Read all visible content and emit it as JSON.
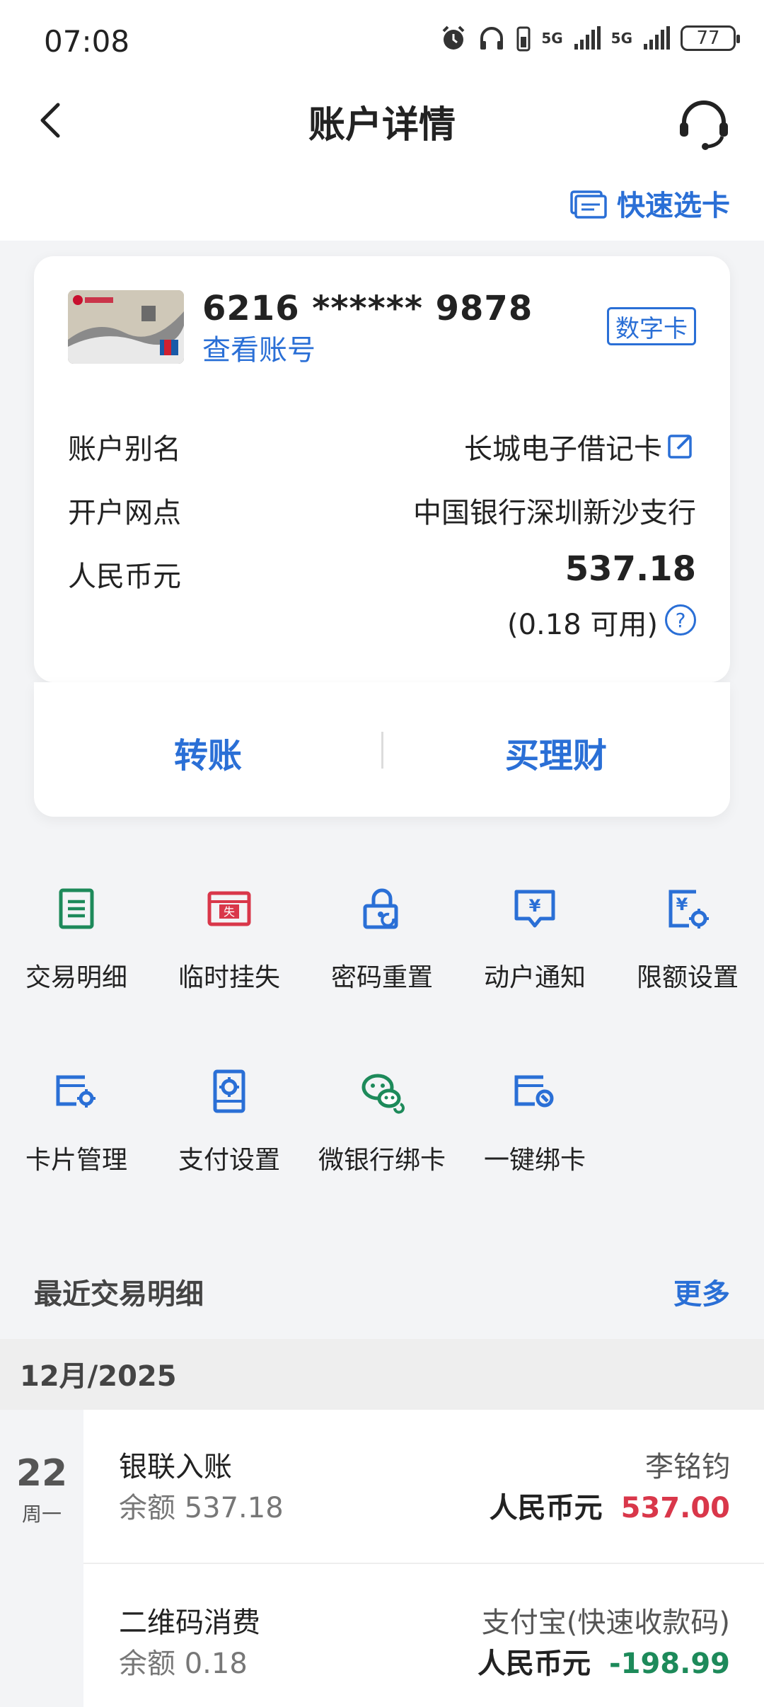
{
  "status_bar": {
    "time": "07:08",
    "battery": "77",
    "signal_labels": [
      "5G",
      "5G"
    ]
  },
  "header": {
    "title": "账户详情",
    "quick_select": "快速选卡"
  },
  "account": {
    "card_number": "6216 ****** 9878",
    "view_number": "查看账号",
    "badge": "数字卡",
    "rows": [
      {
        "label": "账户别名",
        "value": "长城电子借记卡"
      },
      {
        "label": "开户网点",
        "value": "中国银行深圳新沙支行"
      },
      {
        "label": "人民币元",
        "value": "537.18"
      }
    ],
    "available": "(0.18 可用)",
    "help": "?"
  },
  "actions": {
    "transfer": "转账",
    "buy_wealth": "买理财"
  },
  "features": [
    {
      "label": "交易明细",
      "icon": "document-list-icon",
      "color": "#1d8a5a"
    },
    {
      "label": "临时挂失",
      "icon": "card-lost-icon",
      "color": "#d9374a"
    },
    {
      "label": "密码重置",
      "icon": "lock-reset-icon",
      "color": "#2a6fd6"
    },
    {
      "label": "动户通知",
      "icon": "yuan-message-icon",
      "color": "#2a6fd6"
    },
    {
      "label": "限额设置",
      "icon": "yuan-settings-icon",
      "color": "#2a6fd6"
    },
    {
      "label": "卡片管理",
      "icon": "card-settings-icon",
      "color": "#2a6fd6"
    },
    {
      "label": "支付设置",
      "icon": "payment-settings-icon",
      "color": "#2a6fd6"
    },
    {
      "label": "微银行绑卡",
      "icon": "wechat-icon",
      "color": "#1d8a5a"
    },
    {
      "label": "一键绑卡",
      "icon": "card-link-icon",
      "color": "#2a6fd6"
    }
  ],
  "recent": {
    "title": "最近交易明细",
    "more": "更多",
    "month": "12月/2025",
    "day": "22",
    "weekday": "周一",
    "transactions": [
      {
        "title": "银联入账",
        "balance": "余额 537.18",
        "party": "李铭钧",
        "currency": "人民币元",
        "amount": "537.00",
        "color": "#d9374a"
      },
      {
        "title": "二维码消费",
        "balance": "余额 0.18",
        "party": "支付宝(快速收款码)",
        "currency": "人民币元",
        "amount": "-198.99",
        "color": "#1d8a5a"
      }
    ]
  }
}
